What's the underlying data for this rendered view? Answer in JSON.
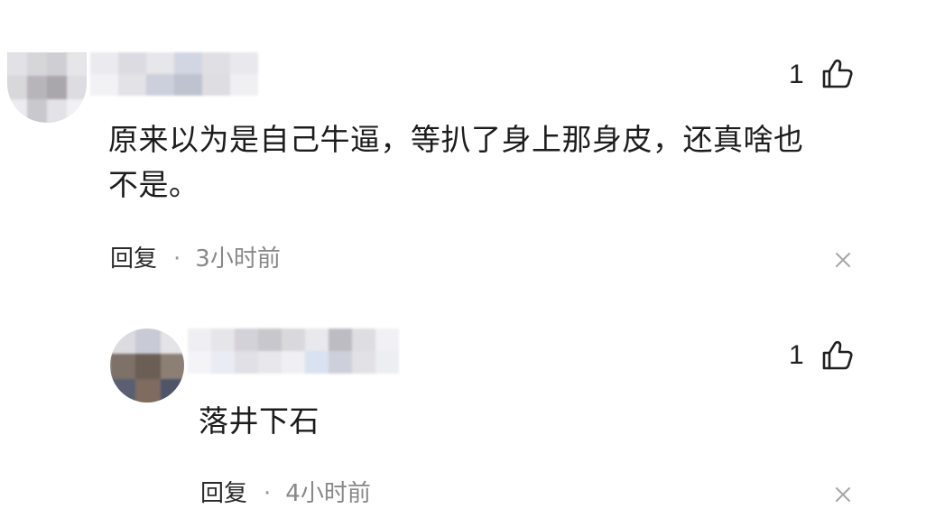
{
  "comments": [
    {
      "likes": "1",
      "text_line1": "原来以为是自己牛逼，等扒了身上那身皮，还真啥也",
      "text_line2": "不是。",
      "reply_label": "回复",
      "separator": "·",
      "time": "3小时前"
    },
    {
      "likes": "1",
      "text_line1": "落井下石",
      "reply_label": "回复",
      "separator": "·",
      "time": "4小时前"
    }
  ],
  "icons": {
    "like": "thumbs-up-icon",
    "dismiss": "close-icon"
  },
  "colors": {
    "text": "#1c1c1c",
    "meta": "#888888",
    "background": "#ffffff"
  }
}
